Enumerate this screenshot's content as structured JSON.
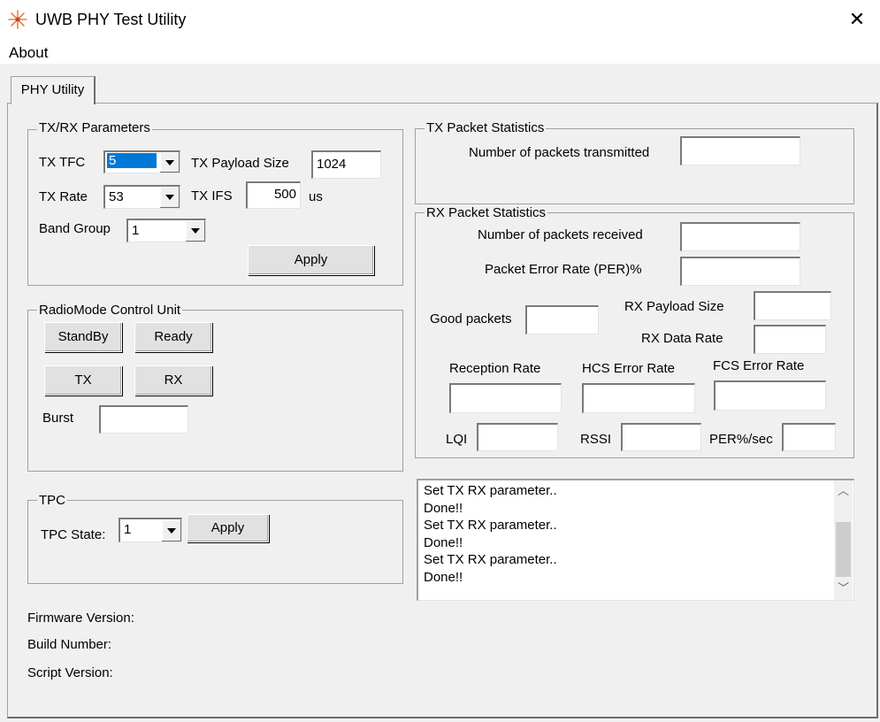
{
  "window": {
    "title": "UWB PHY Test Utility",
    "close_glyph": "✕",
    "icon": "uwb-star-logo-icon"
  },
  "menu": {
    "about": "About"
  },
  "tabs": [
    {
      "label": "PHY Utility",
      "active": true
    }
  ],
  "txrx_params": {
    "title": "TX/RX Parameters",
    "tx_tfc_label": "TX TFC",
    "tx_tfc_value": "5",
    "tx_payload_label": "TX Payload Size",
    "tx_payload_value": "1024",
    "tx_rate_label": "TX Rate",
    "tx_rate_value": "53",
    "tx_ifs_label": "TX IFS",
    "tx_ifs_value": "500",
    "tx_ifs_unit": "us",
    "band_group_label": "Band Group",
    "band_group_value": "1",
    "apply_label": "Apply"
  },
  "radio_mode": {
    "title": "RadioMode Control Unit",
    "standby_label": "StandBy",
    "ready_label": "Ready",
    "tx_label": "TX",
    "rx_label": "RX",
    "burst_label": "Burst",
    "burst_value": ""
  },
  "tpc": {
    "title": "TPC",
    "state_label": "TPC State:",
    "state_value": "1",
    "apply_label": "Apply"
  },
  "info": {
    "firmware_label": "Firmware Version:",
    "build_label": "Build Number:",
    "script_label": "Script Version:"
  },
  "tx_stats": {
    "title": "TX Packet Statistics",
    "packets_tx_label": "Number of packets transmitted",
    "packets_tx_value": ""
  },
  "rx_stats": {
    "title": "RX Packet Statistics",
    "packets_rx_label": "Number of packets received",
    "per_label": "Packet Error Rate (PER)%",
    "good_packets_label": "Good packets",
    "rx_payload_label": "RX Payload Size",
    "rx_data_rate_label": "RX Data Rate",
    "reception_rate_label": "Reception Rate",
    "hcs_error_label": "HCS Error Rate",
    "fcs_error_label": "FCS Error Rate",
    "lqi_label": "LQI",
    "rssi_label": "RSSI",
    "per_sec_label": "PER%/sec"
  },
  "log": {
    "lines": [
      "Set TX RX parameter..",
      "Done!!",
      "Set TX RX parameter..",
      "Done!!",
      "Set TX RX parameter..",
      "Done!!"
    ],
    "scroll_up_glyph": "︿",
    "scroll_down_glyph": "﹀"
  }
}
